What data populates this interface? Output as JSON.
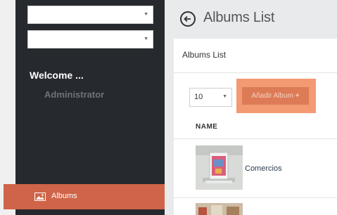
{
  "sidebar": {
    "dropdown1_value": "",
    "dropdown2_value": "",
    "welcome": "Welcome ...",
    "user": "Administrator",
    "active_item": {
      "icon": "image-icon",
      "label": "Albums"
    }
  },
  "header": {
    "back_icon": "arrow-left-circle-icon",
    "title": "Albums List"
  },
  "panel": {
    "title": "Albums List",
    "per_page": "10",
    "add_button": "Añadir Album",
    "add_icon": "plus-icon",
    "column_name": "NAME",
    "rows": [
      {
        "name": "Comercios",
        "thumb": "album-thumbnail"
      },
      {
        "name": "",
        "thumb": "album-thumbnail"
      }
    ]
  },
  "colors": {
    "sidebar": "#26292d",
    "active": "#cf6448",
    "accent": "#dc7b56",
    "highlight": "#f39a73"
  }
}
